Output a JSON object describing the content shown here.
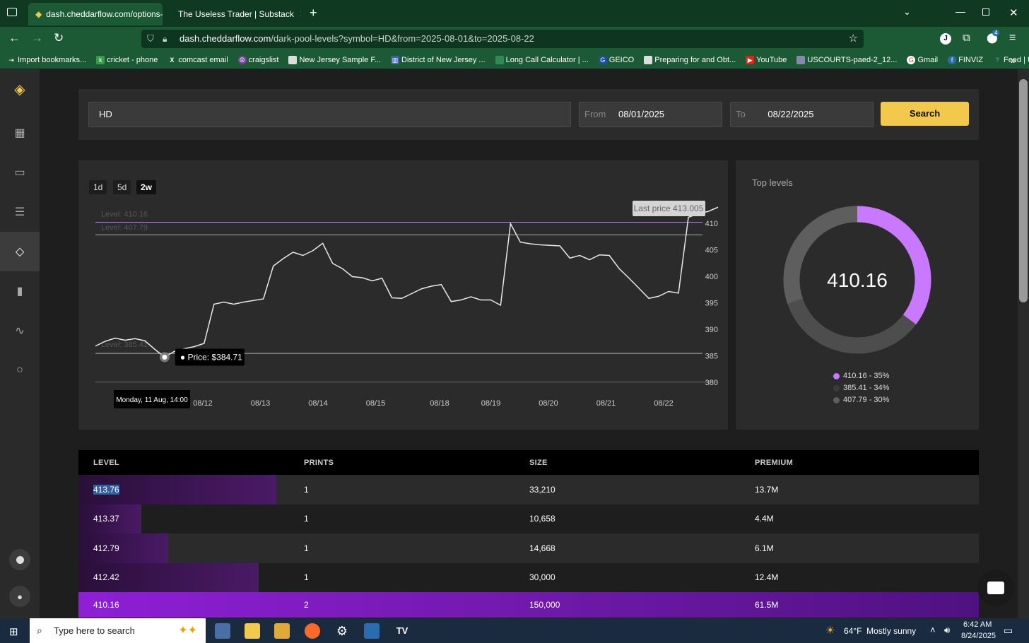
{
  "browser": {
    "tabs": [
      {
        "label": "dash.cheddarflow.com/options-"
      },
      {
        "label": "The Useless Trader | Substack"
      }
    ],
    "url_host": "dash.cheddarflow.com",
    "url_path": "/dark-pool-levels?symbol=HD&from=2025-08-01&to=2025-08-22",
    "extension_badge": "4",
    "bookmarks": [
      "Import bookmarks...",
      "cricket - phone",
      "comcast email",
      "craigslist",
      "New Jersey Sample F...",
      "District of New Jersey ...",
      "Long Call Calculator | ...",
      "GEICO",
      "Preparing for and Obt...",
      "YouTube",
      "USCOURTS-paed-2_12...",
      "Gmail",
      "FINVIZ",
      "Feed | Utradea"
    ]
  },
  "search": {
    "symbol": "HD",
    "from_label": "From",
    "from_value": "08/01/2025",
    "to_label": "To",
    "to_value": "08/22/2025",
    "button": "Search"
  },
  "timeframes": [
    "1d",
    "5d",
    "2w"
  ],
  "active_timeframe": "2w",
  "chart_data": {
    "type": "line",
    "x_ticks": [
      "08/12",
      "08/13",
      "08/14",
      "08/15",
      "08/18",
      "08/19",
      "08/20",
      "08/21",
      "08/22"
    ],
    "y_ticks": [
      380,
      385,
      390,
      395,
      400,
      405,
      410
    ],
    "ylim": [
      378.5,
      412.5
    ],
    "levels": [
      {
        "label": "Level: 410.16",
        "value": 410.16,
        "color": "#c879ff"
      },
      {
        "label": "Level: 407.79",
        "value": 407.79,
        "color": "#aaaaaa"
      },
      {
        "label": "Level: 385.41",
        "value": 385.41,
        "color": "#aaaaaa"
      }
    ],
    "series": [
      {
        "values": [
          386.8,
          387.7,
          388.3,
          387.9,
          388.2,
          387.8,
          386.2,
          384.7,
          385.8,
          386.3,
          386.7,
          387.3,
          394.7,
          395.1,
          394.7,
          395.1,
          395.4,
          395.7,
          401.9,
          403.3,
          404.5,
          403.9,
          404.8,
          406.2,
          402.4,
          401.4,
          399.9,
          399.7,
          399.1,
          399.6,
          395.9,
          395.8,
          396.7,
          397.6,
          398.1,
          398.4,
          395.2,
          395.5,
          396.1,
          395.5,
          395.5,
          394.5,
          409.9,
          406.4,
          406.1,
          405.9,
          405.8,
          405.7,
          403.4,
          403.9,
          403.1,
          404.0,
          403.9,
          401.4,
          399.6,
          397.7,
          395.8,
          396.2,
          397.1,
          396.8,
          411.1,
          411.8,
          412.2,
          413.0
        ]
      }
    ],
    "last_price_label": "Last price 413.005",
    "tooltip_price": "Price: $384.71",
    "tooltip_date": "Monday, 11 Aug, 14:00"
  },
  "top_levels": {
    "title": "Top levels",
    "center_value": "410.16",
    "slices": [
      {
        "label": "410.16 - 35%",
        "percent": 35,
        "color": "#c879ff"
      },
      {
        "label": "385.41 - 34%",
        "percent": 34,
        "color": "#4d4d4d"
      },
      {
        "label": "407.79 - 30%",
        "percent": 30,
        "color": "#5e5e5e"
      }
    ]
  },
  "table": {
    "headers": [
      "LEVEL",
      "PRINTS",
      "SIZE",
      "PREMIUM"
    ],
    "rows": [
      {
        "level": "413.76",
        "prints": "1",
        "size": "33,210",
        "premium": "13.7M",
        "bar": 0.22
      },
      {
        "level": "413.37",
        "prints": "1",
        "size": "10,658",
        "premium": "4.4M",
        "bar": 0.07
      },
      {
        "level": "412.79",
        "prints": "1",
        "size": "14,668",
        "premium": "6.1M",
        "bar": 0.1
      },
      {
        "level": "412.42",
        "prints": "1",
        "size": "30,000",
        "premium": "12.4M",
        "bar": 0.2
      },
      {
        "level": "410.16",
        "prints": "2",
        "size": "150,000",
        "premium": "61.5M",
        "bar": 1.0
      }
    ]
  },
  "taskbar": {
    "search_placeholder": "Type here to search",
    "weather": "64°F  Mostly sunny",
    "time": "6:42 AM",
    "date": "8/24/2025"
  }
}
